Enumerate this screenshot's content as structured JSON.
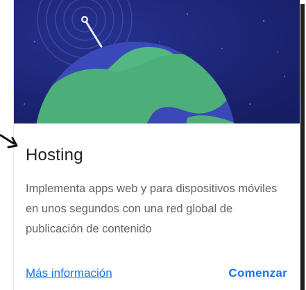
{
  "card": {
    "title": "Hosting",
    "description": "Implementa apps web y para dispositivos móviles en unos segundos con una red global de publicación de contenido",
    "more_link": "Más información",
    "start_button": "Comenzar"
  },
  "icons": {
    "hero": "globe-with-antenna-illustration",
    "pointer": "pointer-arrow-icon"
  },
  "colors": {
    "hero_background": "#1c2474",
    "ocean": "#3b49b8",
    "land": "#4caf7a",
    "link": "#1a73e8",
    "title": "#202124",
    "text": "#5f6368"
  }
}
